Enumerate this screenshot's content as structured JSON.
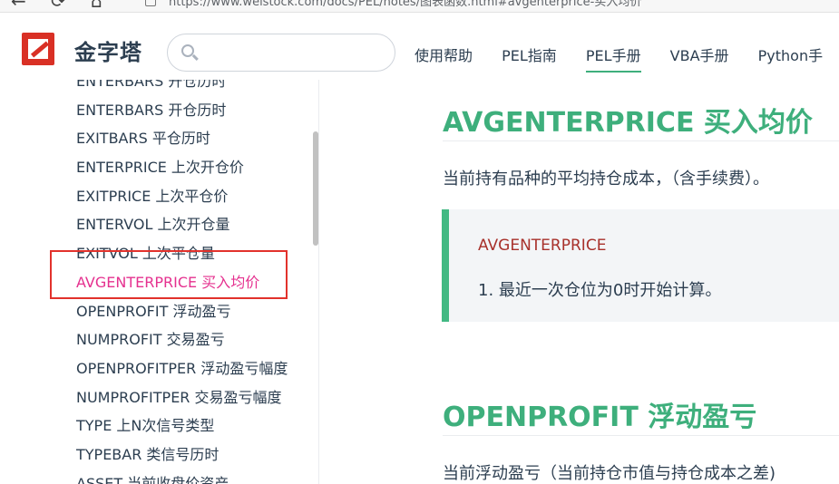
{
  "browser": {
    "url": "https://www.weistock.com/docs/PEL/notes/图表函数.html#avgenterprice-买入均价",
    "back_icon": "←",
    "reload_icon": "⟳",
    "home_icon": "⌂"
  },
  "header": {
    "site_name": "金字塔",
    "search_value": "",
    "nav": [
      {
        "label": "使用帮助"
      },
      {
        "label": "PEL指南"
      },
      {
        "label": "PEL手册"
      },
      {
        "label": "VBA手册"
      },
      {
        "label": "Python手"
      }
    ],
    "active_nav": "PEL手册"
  },
  "sidebar": {
    "items": [
      {
        "label": "ENTERBARS 开仓历时"
      },
      {
        "label": "ENTERBARS 开仓历时"
      },
      {
        "label": "EXITBARS 平仓历时"
      },
      {
        "label": "ENTERPRICE 上次开仓价"
      },
      {
        "label": "EXITPRICE 上次平仓价"
      },
      {
        "label": "ENTERVOL 上次开仓量"
      },
      {
        "label": "EXITVOL 上次平仓量"
      },
      {
        "label": "AVGENTERPRICE 买入均价"
      },
      {
        "label": "OPENPROFIT 浮动盈亏"
      },
      {
        "label": "NUMPROFIT 交易盈亏"
      },
      {
        "label": "OPENPROFITPER 浮动盈亏幅度"
      },
      {
        "label": "NUMPROFITPER 交易盈亏幅度"
      },
      {
        "label": "TYPE 上N次信号类型"
      },
      {
        "label": "TYPEBAR 类信号历时"
      },
      {
        "label": "ASSET 当前收盘价资产"
      }
    ],
    "active_index": 7
  },
  "content": {
    "section1": {
      "title": "AVGENTERPRICE 买入均价",
      "description": "当前持有品种的平均持仓成本，（含手续费）。",
      "callout_title": "AVGENTERPRICE",
      "callout_item": "1. 最近一次仓位为0时开始计算。"
    },
    "section2": {
      "title": "OPENPROFIT 浮动盈亏",
      "description": "当前浮动盈亏（当前持仓市值与持仓成本之差)"
    }
  },
  "colors": {
    "accent": "#3eaf7c",
    "active_link": "#e5318f",
    "highlight_box": "#e2322c",
    "callout_title": "#a8312b",
    "logo": "#d93025"
  }
}
